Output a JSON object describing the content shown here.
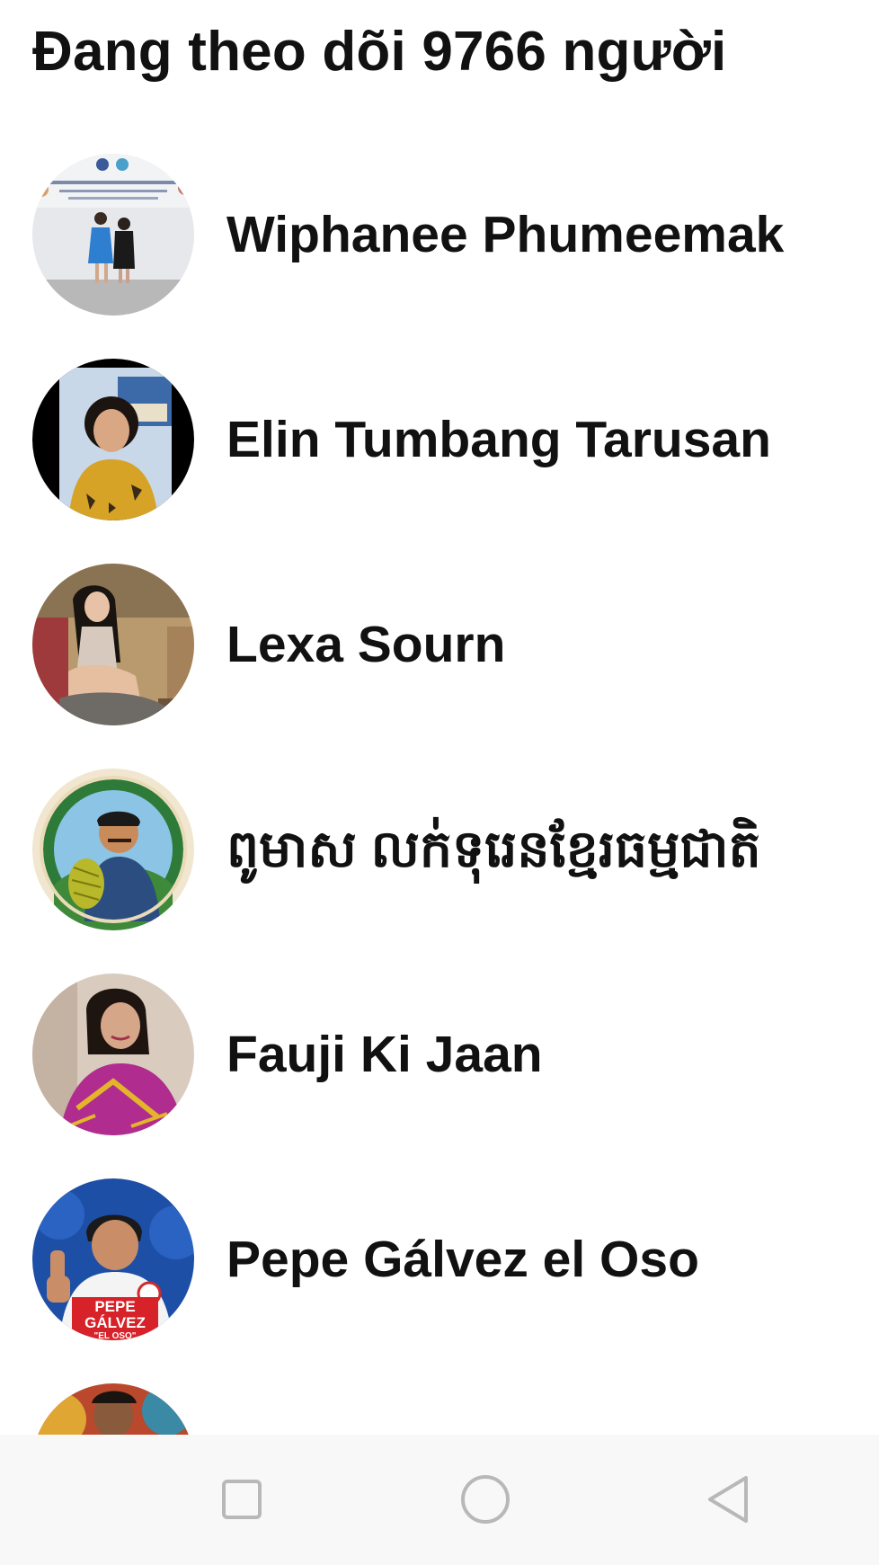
{
  "header": {
    "title": "Đang theo dõi 9766 người"
  },
  "following": [
    {
      "name": "Wiphanee Phumeemak",
      "avatar": "photo-two-women-at-event"
    },
    {
      "name": "Elin Tumbang Tarusan",
      "avatar": "photo-woman-yellow-dress"
    },
    {
      "name": "Lexa Sourn",
      "avatar": "photo-woman-sitting"
    },
    {
      "name": "ពូមាស លក់ទុរេនខ្មែរធម្មជាតិ",
      "avatar": "illustrated-logo-durian-seller"
    },
    {
      "name": "Fauji Ki Jaan",
      "avatar": "photo-woman-pink-saree"
    },
    {
      "name": "Pepe Gálvez el Oso",
      "avatar": "campaign-photo-thumbs-up"
    },
    {
      "name": "",
      "avatar": "photo-partially-visible"
    }
  ],
  "avatar_texts": {
    "pepe_line1": "PEPE",
    "pepe_line2": "GÁLVEZ",
    "pepe_line3": "\"EL OSO\""
  },
  "navigation": {
    "recents_icon": "square-icon",
    "home_icon": "circle-icon",
    "back_icon": "triangle-back-icon"
  },
  "colors": {
    "background": "#ffffff",
    "text": "#111111",
    "navbar": "#f8f8f8",
    "nav_icon": "#b8b8b8"
  }
}
